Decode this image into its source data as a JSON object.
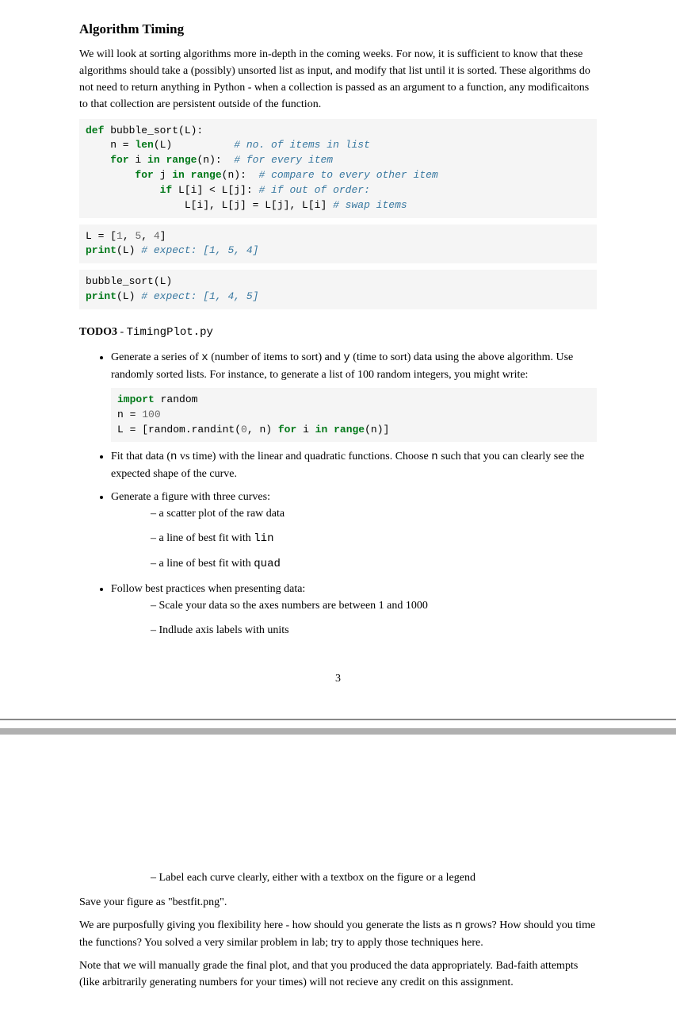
{
  "heading": "Algorithm Timing",
  "intro": "We will look at sorting algorithms more in-depth in the coming weeks. For now, it is sufficient to know that these algorithms should take a (possibly) unsorted list as input, and modify that list until it is sorted. These algorithms do not need to return anything in Python - when a collection is passed as an argument to a function, any modificaitons to that collection are persistent outside of the function.",
  "code1": {
    "l1a": "def",
    "l1b": " bubble_sort(L):",
    "l2a": "    n = ",
    "l2b": "len",
    "l2c": "(L)          ",
    "l2d": "# no. of items in list",
    "l3a": "    ",
    "l3b": "for",
    "l3c": " i ",
    "l3d": "in",
    "l3e": " ",
    "l3f": "range",
    "l3g": "(n):  ",
    "l3h": "# for every item",
    "l4a": "        ",
    "l4b": "for",
    "l4c": " j ",
    "l4d": "in",
    "l4e": " ",
    "l4f": "range",
    "l4g": "(n):  ",
    "l4h": "# compare to every other item",
    "l5a": "            ",
    "l5b": "if",
    "l5c": " L[i] < L[j]: ",
    "l5d": "# if out of order:",
    "l6a": "                L[i], L[j] = L[j], L[i] ",
    "l6b": "# swap items"
  },
  "code2": {
    "l1a": "L = [",
    "l1b": "1",
    "l1c": ", ",
    "l1d": "5",
    "l1e": ", ",
    "l1f": "4",
    "l1g": "]",
    "l2a": "print",
    "l2b": "(L) ",
    "l2c": "# expect: [1, 5, 4]"
  },
  "code3": {
    "l1": "bubble_sort(L)",
    "l2a": "print",
    "l2b": "(L) ",
    "l2c": "# expect: [1, 4, 5]"
  },
  "todo": {
    "label": "TODO3",
    "sep": " - ",
    "file": "TimingPlot.py"
  },
  "bullets": {
    "b1a": "Generate a series of ",
    "b1b": "x",
    "b1c": " (number of items to sort) and ",
    "b1d": "y",
    "b1e": " (time to sort) data using the above algorithm. Use randomly sorted lists. For instance, to generate a list of 100 random integers, you might write:",
    "b2a": "Fit that data (",
    "b2b": "n",
    "b2c": " vs time) with the linear and quadratic functions. Choose ",
    "b2d": "n",
    "b2e": " such that you can clearly see the expected shape of the curve.",
    "b3": "Generate a figure with three curves:",
    "b3s1": "a scatter plot of the raw data",
    "b3s2a": "a line of best fit with ",
    "b3s2b": "lin",
    "b3s3a": "a line of best fit with ",
    "b3s3b": "quad",
    "b4": "Follow best practices when presenting data:",
    "b4s1": "Scale your data so the axes numbers are between 1 and 1000",
    "b4s2": "Indlude axis labels with units"
  },
  "code4": {
    "l1a": "import",
    "l1b": " random",
    "l2a": "n = ",
    "l2b": "100",
    "l3a": "L = [random.randint(",
    "l3b": "0",
    "l3c": ", n) ",
    "l3d": "for",
    "l3e": " i ",
    "l3f": "in",
    "l3g": " ",
    "l3h": "range",
    "l3i": "(n)]"
  },
  "pagenum": "3",
  "page2": {
    "dash1": "Label each curve clearly, either with a textbox on the figure or a legend",
    "p1": "Save your figure as \"bestfit.png\".",
    "p2a": "We are purposfully giving you flexibility here - how should you generate the lists as ",
    "p2b": "n",
    "p2c": " grows? How should you time the functions? You solved a very similar problem in lab; try to apply those techniques here.",
    "p3": "Note that we will manually grade the final plot, and that you produced the data appropriately. Bad-faith attempts (like arbitrarily generating numbers for your times) will not recieve any credit on this assignment."
  }
}
